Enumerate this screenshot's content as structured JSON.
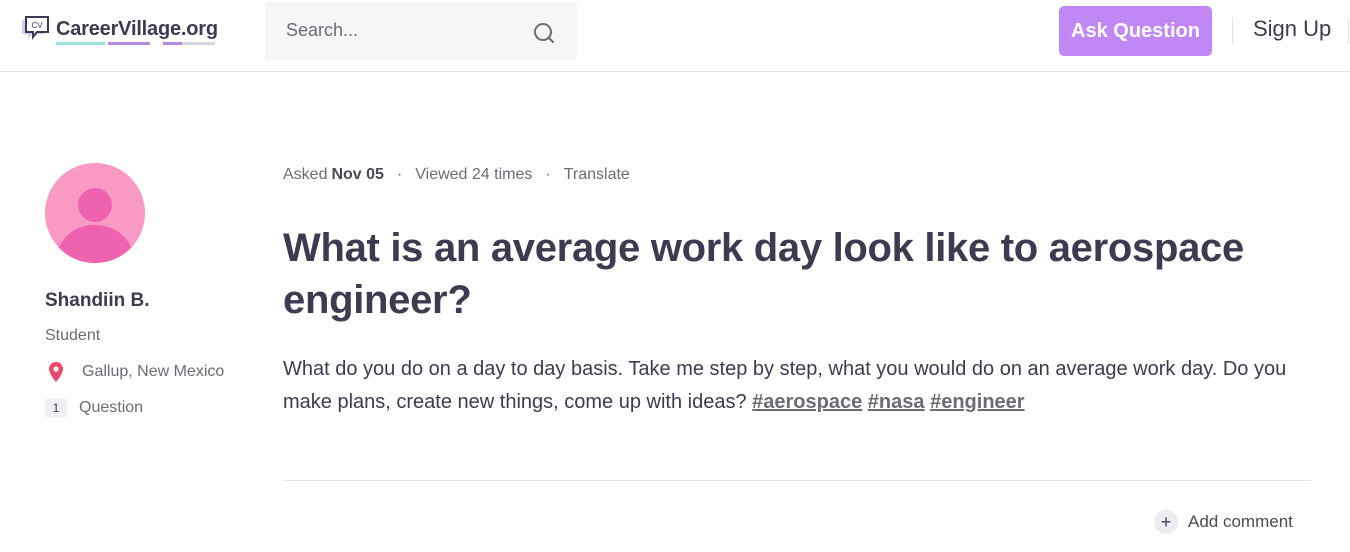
{
  "header": {
    "logo_text": "CareerVillage.org",
    "logo_icon_text": "CV",
    "search_placeholder": "Search...",
    "ask_button": "Ask Question",
    "sign_up": "Sign Up",
    "colors": {
      "accent": "#c187f4",
      "logo_teal": "#9be3dc",
      "logo_purple": "#b48ae8"
    }
  },
  "author": {
    "name": "Shandiin B.",
    "role": "Student",
    "location": "Gallup, New Mexico",
    "question_count": "1",
    "question_label": "Question",
    "avatar_color": "#f89ac4"
  },
  "question": {
    "asked_label": "Asked",
    "asked_date": "Nov 05",
    "views": "Viewed 24 times",
    "translate": "Translate",
    "title": "What is an average work day look like to aerospace engineer?",
    "body": "What do you do on a day to day basis. Take me step by step, what you would do on an average work day. Do you make plans, create new things, come up with ideas?",
    "tags": [
      "#aerospace",
      "#nasa",
      "#engineer"
    ]
  },
  "actions": {
    "add_comment": "Add comment"
  }
}
